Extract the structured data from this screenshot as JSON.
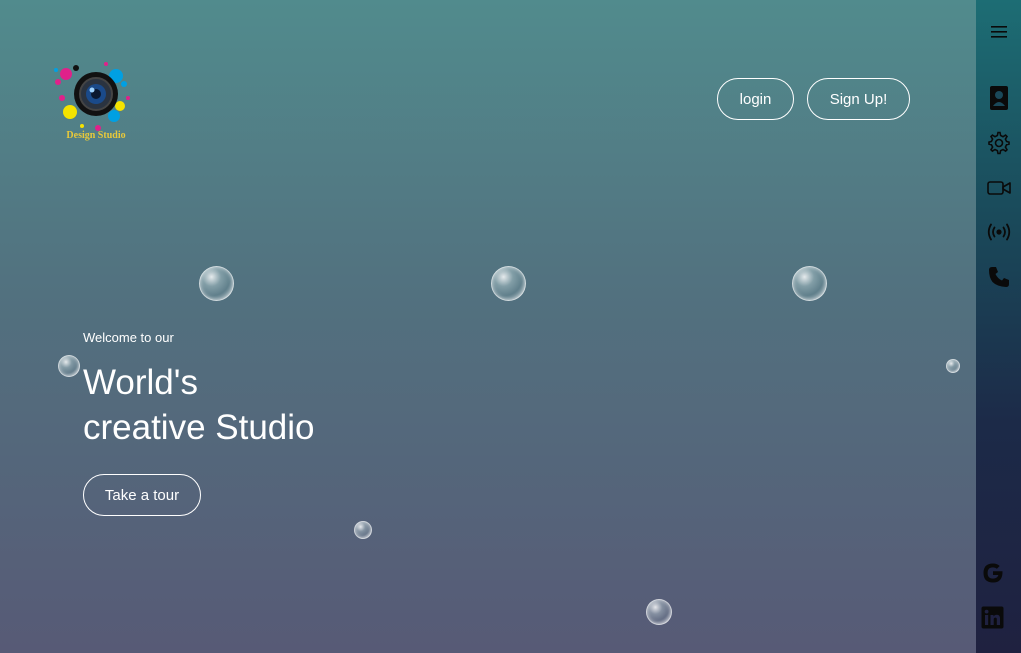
{
  "logo": {
    "caption": "Design Studio",
    "icon": "camera-lens-logo"
  },
  "header": {
    "login_label": "login",
    "signup_label": "Sign Up!"
  },
  "hero": {
    "welcome": "Welcome to our",
    "headline_line1": "World's",
    "headline_line2": "creative Studio",
    "tour_label": "Take a tour"
  },
  "sidebar": {
    "icons": [
      "menu-icon",
      "contact-card-icon",
      "gear-icon",
      "video-camera-icon",
      "broadcast-icon",
      "phone-icon",
      "google-icon",
      "linkedin-icon"
    ]
  },
  "colors": {
    "accent": "#ffffff",
    "sidebar_top": "#1d6d74",
    "sidebar_bottom": "#1f2140",
    "logo_caption": "#e8c93a"
  }
}
